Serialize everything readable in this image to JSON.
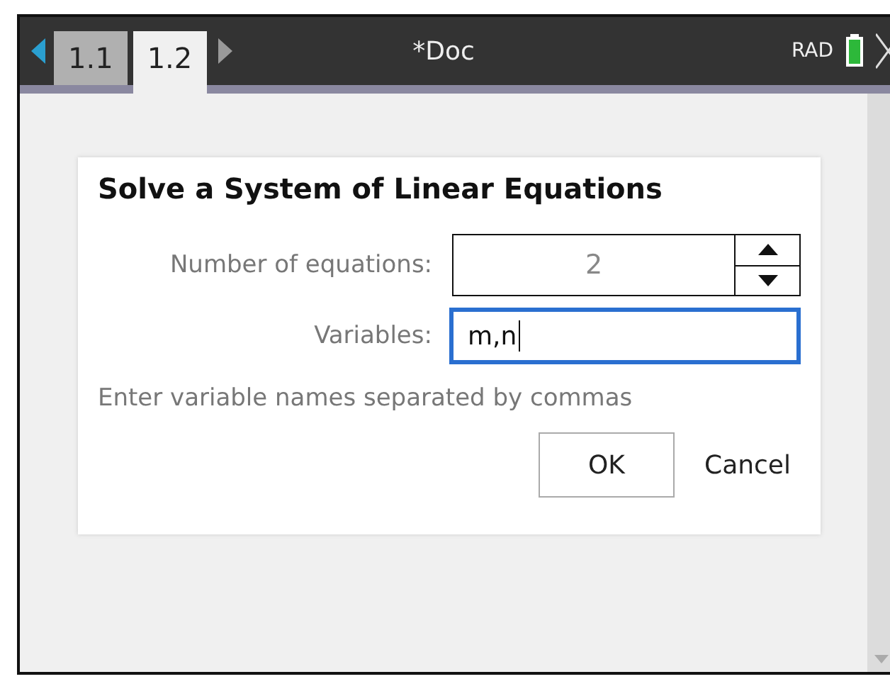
{
  "header": {
    "tabs": [
      {
        "label": "1.1",
        "selected": false
      },
      {
        "label": "1.2",
        "selected": true
      }
    ],
    "document_title": "*Doc",
    "angle_mode": "RAD"
  },
  "dialog": {
    "title": "Solve a System of Linear Equations",
    "fields": [
      {
        "kind": "spinner",
        "label": "Number of equations:",
        "value": "2"
      },
      {
        "kind": "text",
        "label": "Variables:",
        "value": "m,n",
        "focused": true
      }
    ],
    "hint": "Enter variable names separated by commas",
    "buttons": [
      {
        "label": "OK",
        "kind": "default"
      },
      {
        "label": "Cancel",
        "kind": "plain"
      }
    ]
  }
}
